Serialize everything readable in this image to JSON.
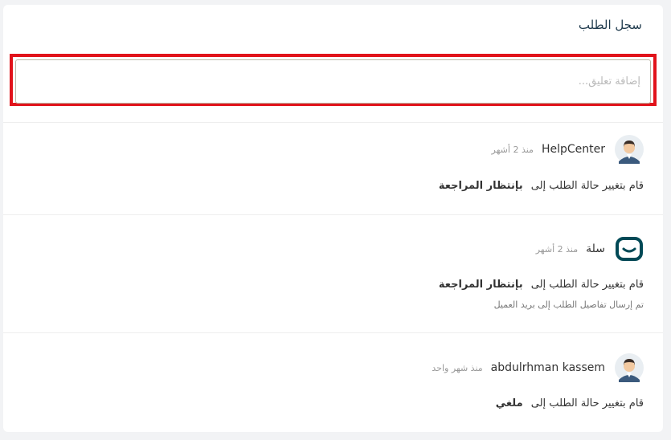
{
  "title": "سجل الطلب",
  "comment": {
    "placeholder": "إضافة تعليق...",
    "value": ""
  },
  "colors": {
    "highlight": "#e1131b",
    "brand": "#004956",
    "avatar_bg": "#e9eef2"
  },
  "entries": [
    {
      "author": "HelpCenter",
      "time": "منذ 2 أشهر",
      "action_prefix": "قام بتغيير حالة الطلب إلى",
      "status": "بإنتظار المراجعة",
      "note": "",
      "avatar_icon": "user-avatar-icon"
    },
    {
      "author": "سلة",
      "time": "منذ 2 أشهر",
      "action_prefix": "قام بتغيير حالة الطلب إلى",
      "status": "بإنتظار المراجعة",
      "note": "تم إرسال تفاصيل الطلب إلى بريد العميل",
      "avatar_icon": "salla-logo-icon"
    },
    {
      "author": "abdulrhman kassem",
      "time": "منذ شهر واحد",
      "action_prefix": "قام بتغيير حالة الطلب إلى",
      "status": "ملغي",
      "note": "",
      "avatar_icon": "user-avatar-icon"
    }
  ]
}
